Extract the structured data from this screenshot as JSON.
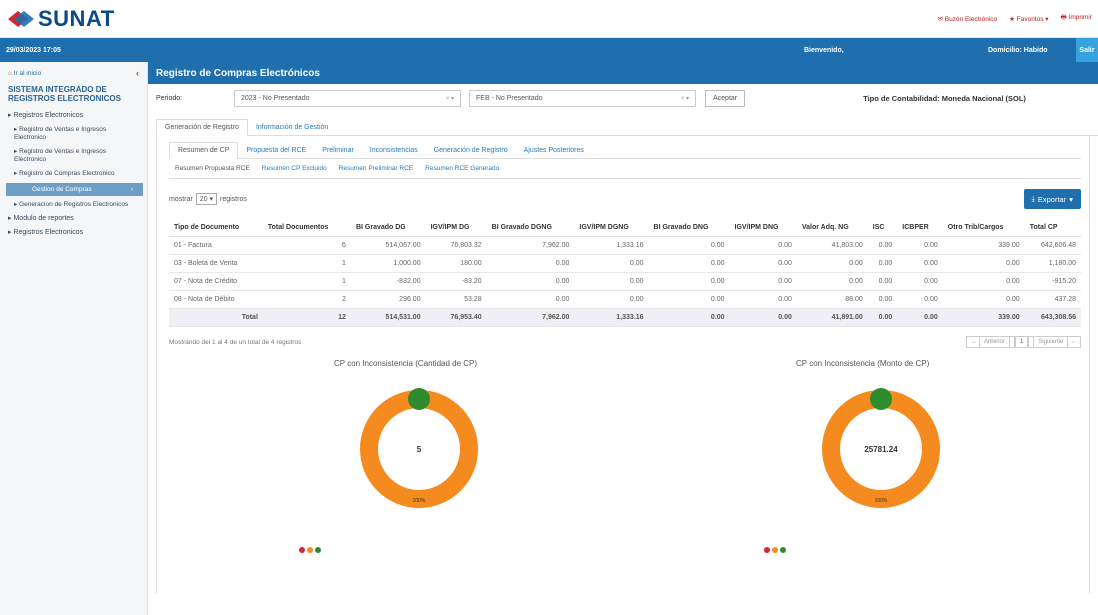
{
  "header": {
    "brand": "SUNAT",
    "links": [
      "Buzón Electrónico",
      "Favoritos",
      "Imprimir"
    ],
    "datetime": "29/03/2023 17:05",
    "welcome": "Bienvenido,",
    "domicile": "Domicilio: Habido",
    "exit": "Salir"
  },
  "sidebar": {
    "home": "Ir al inicio",
    "title": "SISTEMA INTEGRADO DE REGISTROS ELECTRONICOS",
    "items": [
      "Registros Electronicos",
      "Registro de Ventas e Ingresos Electronico",
      "Registro de Ventas e Ingresos Electronico",
      "Registro de Compras Electronico",
      "Gestion de Compras",
      "Generacion de Registros Electronicos",
      "Modulo de reportes",
      "Registros Electronicos"
    ]
  },
  "main": {
    "title": "Registro de Compras Electrónicos",
    "period_label": "Periodo:",
    "period_year": "2023 - No Presentado",
    "period_month": "FEB - No Presentado",
    "accept": "Aceptar",
    "accounting": "Tipo de Contabilidad: Moneda Nacional (SOL)",
    "tabs1": [
      "Generación de Registro",
      "Información de Gestión"
    ],
    "tabs2": [
      "Resumen de CP",
      "Propuesta del RCE",
      "Preliminar",
      "Inconsistencias",
      "Generación de Registro",
      "Ajustes Posteriores"
    ],
    "tabs3": [
      "Resumen Propuesta RCE",
      "Resumen CP Excluido",
      "Resumen Preliminar RCE",
      "Resumen RCE Generado"
    ],
    "show_label": "mostrar",
    "page_len": "20",
    "records": "registros",
    "export": "Exportar",
    "pager_info": "Mostrando del 1 al 4 de un total de 4 registros",
    "prev": "Anterior",
    "page": "1",
    "next": "Siguiente"
  },
  "table": {
    "columns": [
      "Tipo de Documento",
      "Total Documentos",
      "BI Gravado DG",
      "IGV/IPM DG",
      "BI Gravado DGNG",
      "IGV/IPM DGNG",
      "BI Gravado DNG",
      "IGV/IPM DNG",
      "Valor Adq. NG",
      "ISC",
      "ICBPER",
      "Otro Trib/Cargos",
      "Total CP"
    ],
    "rows": [
      [
        "01 - Factura",
        "6",
        "514,067.00",
        "76,803.32",
        "7,962.00",
        "1,333.16",
        "0.00",
        "0.00",
        "41,803.00",
        "0.00",
        "0.00",
        "339.00",
        "642,606.48"
      ],
      [
        "03 - Boleta de Venta",
        "1",
        "1,000.00",
        "180.00",
        "0.00",
        "0.00",
        "0.00",
        "0.00",
        "0.00",
        "0.00",
        "0.00",
        "0.00",
        "1,180.00"
      ],
      [
        "07 - Nota de Crédito",
        "1",
        "-832.00",
        "-83.20",
        "0.00",
        "0.00",
        "0.00",
        "0.00",
        "0.00",
        "0.00",
        "0.00",
        "0.00",
        "-915.20"
      ],
      [
        "08 - Nota de Débito",
        "2",
        "296.00",
        "53.28",
        "0.00",
        "0.00",
        "0.00",
        "0.00",
        "88.00",
        "0.00",
        "0.00",
        "0.00",
        "437.28"
      ]
    ],
    "total": [
      "Total",
      "12",
      "514,531.00",
      "76,953.40",
      "7,962.00",
      "1,333.16",
      "0.00",
      "0.00",
      "41,891.00",
      "0.00",
      "0.00",
      "339.00",
      "643,308.56"
    ]
  },
  "charts": {
    "left_title": "CP con Inconsistencia (Cantidad de CP)",
    "left_center": "5",
    "left_pct": "100%",
    "right_title": "CP con Inconsistencia (Monto de CP)",
    "right_center": "25781.24",
    "right_pct": "100%",
    "ring_color": "#f58a1f",
    "marker_color": "#2e8b2e"
  }
}
